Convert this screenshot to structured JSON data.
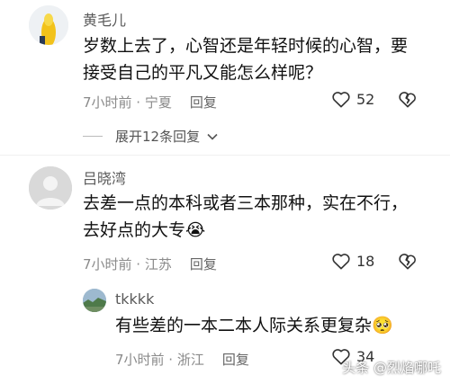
{
  "comments": [
    {
      "username": "黄毛儿",
      "content_lines": [
        "岁数上去了，心智还是年轻时候的心智，要",
        "接受自己的平凡又能怎么样呢？"
      ],
      "time_location": "7小时前 · 宁夏",
      "reply_label": "回复",
      "like_count": "52"
    },
    {
      "username": "吕晓湾",
      "content_lines": [
        "去差一点的本科或者三本那种，实在不行，",
        "去好点的大专😭"
      ],
      "time_location": "7小时前 · 江苏",
      "reply_label": "回复",
      "like_count": "18"
    },
    {
      "username": "tkkkk",
      "content_lines": [
        "有些差的一本二本人际关系更复杂🥺"
      ],
      "time_location": "7小时前 · 浙江",
      "reply_label": "回复",
      "like_count": "34"
    }
  ],
  "expand_replies_label": "展开12条回复",
  "watermark": "头条 @烈焰哪吒",
  "colors": {
    "text": "#111111",
    "meta": "#8a8a8a",
    "accent": "#555555"
  }
}
